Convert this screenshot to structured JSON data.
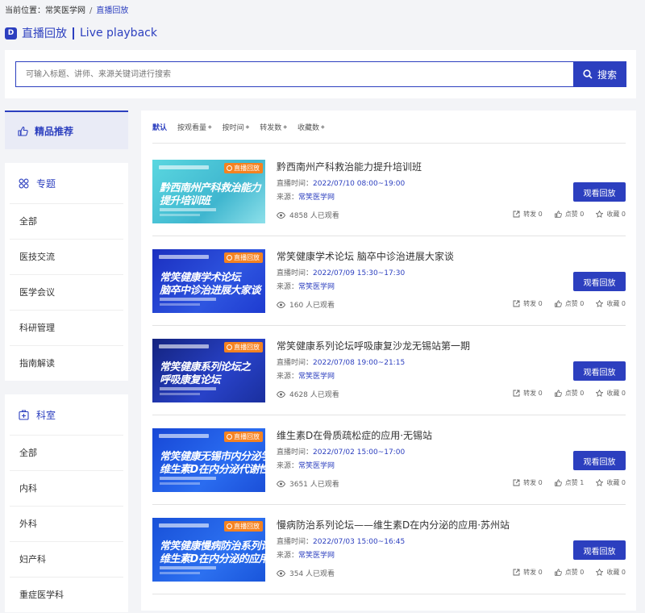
{
  "breadcrumb": {
    "prefix": "当前位置：",
    "home": "常笑医学网",
    "sep": "/",
    "current": "直播回放"
  },
  "header": {
    "icon_glyph": "D",
    "title": "直播回放",
    "title_en": "Live playback"
  },
  "search": {
    "placeholder": "可输入标题、讲师、来源关键词进行搜索",
    "button_label": "搜索"
  },
  "sidebar": {
    "featured_label": "精品推荐",
    "topic": {
      "title": "专题",
      "items": [
        "全部",
        "医技交流",
        "医学会议",
        "科研管理",
        "指南解读"
      ]
    },
    "dept": {
      "title": "科室",
      "items": [
        "全部",
        "内科",
        "外科",
        "妇产科",
        "重症医学科"
      ]
    }
  },
  "sorts": [
    "默认",
    "按观看量",
    "按时间",
    "转发数",
    "收藏数"
  ],
  "card_labels": {
    "time_prefix": "直播时间：",
    "source_prefix": "来源：",
    "watch_button": "观看回放",
    "badge": "直播回放",
    "forward": "转发",
    "like": "点赞",
    "fav": "收藏"
  },
  "cards": [
    {
      "title": "黔西南州产科救治能力提升培训班",
      "time": "2022/07/10 08:00~19:00",
      "source": "常笑医学网",
      "views": "4858 人已观看",
      "forward": "0",
      "like": "0",
      "fav": "0",
      "thumb_line1": "黔西南州产科救治能力",
      "thumb_line2": "提升培训班"
    },
    {
      "title": "常笑健康学术论坛 脑卒中诊治进展大家谈",
      "time": "2022/07/09 15:30~17:30",
      "source": "常笑医学网",
      "views": "160 人已观看",
      "forward": "0",
      "like": "0",
      "fav": "0",
      "thumb_line1": "常笑健康学术论坛",
      "thumb_line2": "脑卒中诊治进展大家谈"
    },
    {
      "title": "常笑健康系列论坛呼吸康复沙龙无锡站第一期",
      "time": "2022/07/08 19:00~21:15",
      "source": "常笑医学网",
      "views": "4628 人已观看",
      "forward": "0",
      "like": "0",
      "fav": "0",
      "thumb_line1": "常笑健康系列论坛之",
      "thumb_line2": "呼吸康复论坛"
    },
    {
      "title": "维生素D在骨质疏松症的应用·无锡站",
      "time": "2022/07/02 15:00~17:00",
      "source": "常笑医学网",
      "views": "3651 人已观看",
      "forward": "0",
      "like": "1",
      "fav": "0",
      "thumb_line1": "常笑健康无锡市内分泌学术论坛",
      "thumb_line2": "维生素D在内分泌代谢性疾病的应用"
    },
    {
      "title": "慢病防治系列论坛——维生素D在内分泌的应用·苏州站",
      "time": "2022/07/03 15:00~16:45",
      "source": "常笑医学网",
      "views": "354 人已观看",
      "forward": "0",
      "like": "0",
      "fav": "0",
      "thumb_line1": "常笑健康慢病防治系列论坛",
      "thumb_line2": "维生素D在内分泌的应用"
    }
  ],
  "colors": {
    "brand": "#2c3fbf",
    "badge": "#f58220",
    "thumb1": "#4fd0d8",
    "thumb_dark": "#1d3fcf"
  }
}
